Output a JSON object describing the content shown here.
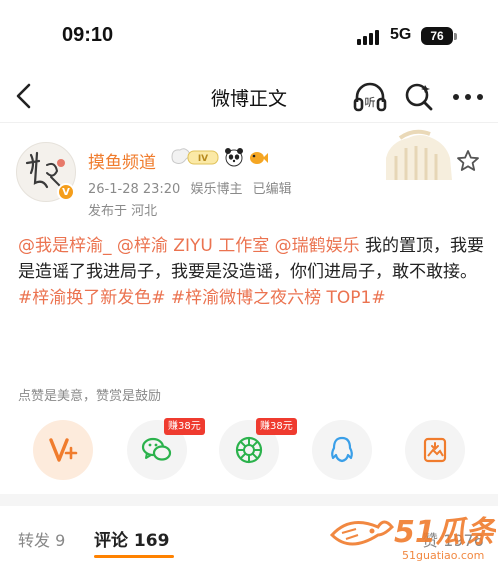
{
  "status_bar": {
    "time": "09:10",
    "network": "5G",
    "battery": "76"
  },
  "nav": {
    "title": "微博正文"
  },
  "post": {
    "author": "摸鱼频道",
    "badge_iv": "IV",
    "date": "26-1-28 23:20",
    "role": "娱乐博主",
    "edited": "已编辑",
    "location": "发布于 河北",
    "text_parts": [
      {
        "text": "@我是梓渝_ @梓渝 ZIYU 工作室 @瑞鹤娱乐",
        "highlight": true
      },
      {
        "text": " 我的置顶，我要是造谣了我进局子，我要是没造谣，你们进局子，敢不敢接。 ",
        "highlight": false
      },
      {
        "text": "#梓渝换了新发色# #梓渝微博之夜六榜 TOP1#",
        "highlight": true
      }
    ]
  },
  "reward": {
    "note": "点赞是美意，赞赏是鼓励",
    "items": [
      {
        "name": "vip-plus",
        "badge": ""
      },
      {
        "name": "wechat",
        "badge": "赚38元"
      },
      {
        "name": "moments",
        "badge": "赚38元"
      },
      {
        "name": "qq",
        "badge": ""
      },
      {
        "name": "save-image",
        "badge": ""
      }
    ]
  },
  "tabs": {
    "repost_label": "转发",
    "repost_count": "9",
    "comment_label": "评论",
    "comment_count": "169",
    "like_label": "赞",
    "like_count": "1976"
  },
  "watermark": {
    "brand": "51瓜条",
    "url": "51guatiao.com"
  },
  "colors": {
    "accent": "#eb7350",
    "brand_orange": "#ff8200",
    "earn_red": "#ef3b2f"
  }
}
